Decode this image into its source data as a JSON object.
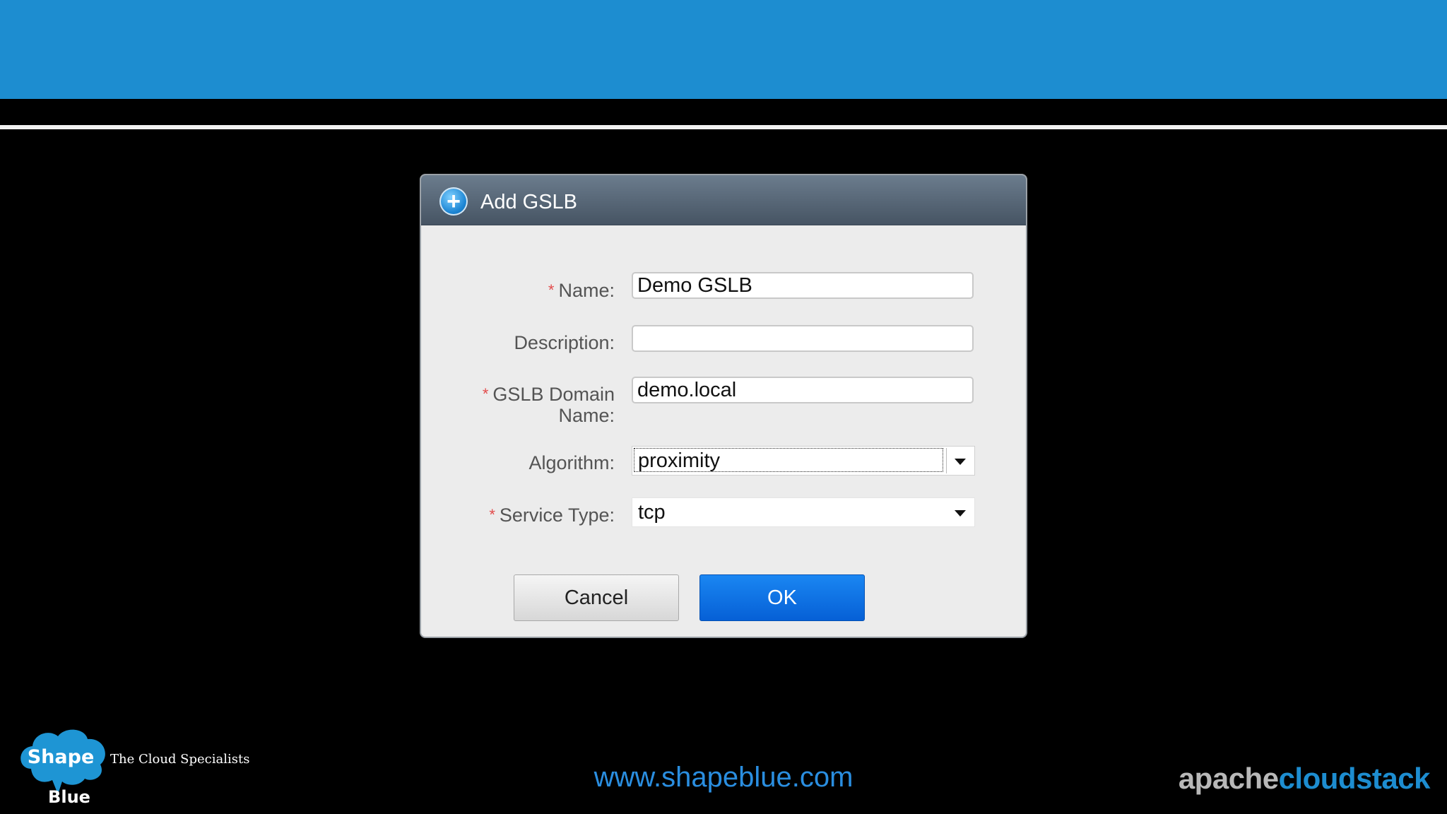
{
  "dialog": {
    "title": "Add GSLB",
    "fields": {
      "name": {
        "label": "Name:",
        "required": true,
        "value": "Demo GSLB"
      },
      "description": {
        "label": "Description:",
        "required": false,
        "value": ""
      },
      "domain": {
        "label_line1": "GSLB Domain",
        "label_line2": "Name:",
        "required": true,
        "value": "demo.local"
      },
      "algorithm": {
        "label": "Algorithm:",
        "required": false,
        "value": "proximity"
      },
      "service_type": {
        "label": "Service Type:",
        "required": true,
        "value": "tcp"
      }
    },
    "required_mark": "*",
    "buttons": {
      "cancel": "Cancel",
      "ok": "OK"
    }
  },
  "footer": {
    "logo_top": "Shape",
    "logo_bottom": "Blue",
    "tagline": "The Cloud Specialists",
    "website": "www.shapeblue.com",
    "brand_part1": "apache",
    "brand_part2": "cloudstack"
  },
  "colors": {
    "top_band": "#1d8dd0",
    "ok_button": "#0a6fe3",
    "required": "#e24b4b",
    "website": "#2a8ee0"
  },
  "icons": {
    "dialog_icon": "plus-circle-icon",
    "dropdown": "chevron-down-icon"
  }
}
